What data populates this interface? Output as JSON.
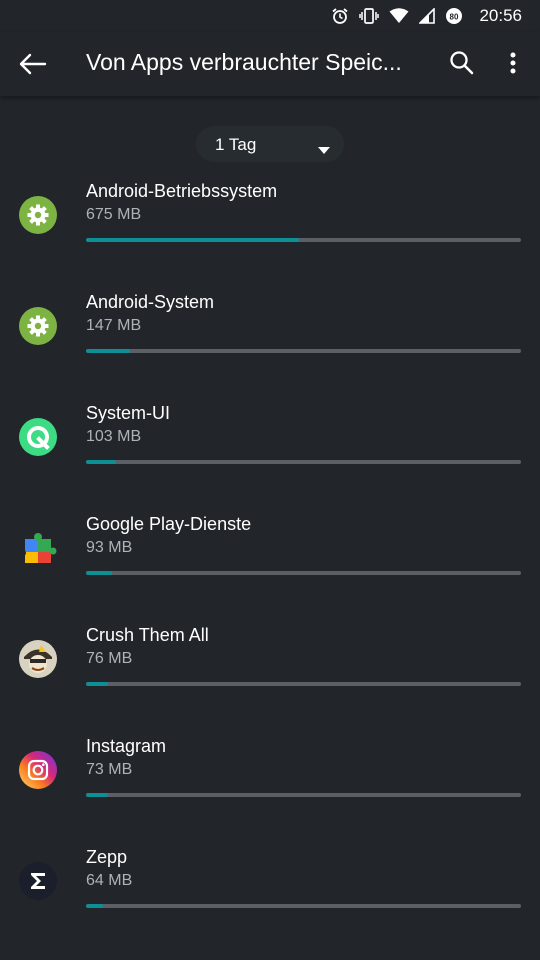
{
  "status_bar": {
    "time": "20:56",
    "icons": [
      "alarm-icon",
      "vibrate-icon",
      "wifi-icon",
      "signal-icon",
      "data-saver-icon"
    ]
  },
  "app_bar": {
    "title": "Von Apps verbrauchter Speic...",
    "back_icon": "arrow-left-icon",
    "search_icon": "search-icon",
    "more_icon": "more-vert-icon"
  },
  "filter": {
    "selected": "1 Tag"
  },
  "colors": {
    "background": "#22262b",
    "accent": "#0e8f96",
    "track": "#5a6066",
    "secondary_text": "#aeb3b8"
  },
  "apps": [
    {
      "name": "Android-Betriebssystem",
      "size": "675 MB",
      "usage_fraction": 0.49,
      "icon": "android-settings-icon"
    },
    {
      "name": "Android-System",
      "size": "147 MB",
      "usage_fraction": 0.1,
      "icon": "android-settings-icon"
    },
    {
      "name": "System-UI",
      "size": "103 MB",
      "usage_fraction": 0.07,
      "icon": "android-q-icon"
    },
    {
      "name": "Google Play-Dienste",
      "size": "93 MB",
      "usage_fraction": 0.06,
      "icon": "play-services-icon"
    },
    {
      "name": "Crush Them All",
      "size": "76 MB",
      "usage_fraction": 0.05,
      "icon": "crush-them-all-icon"
    },
    {
      "name": "Instagram",
      "size": "73 MB",
      "usage_fraction": 0.05,
      "icon": "instagram-icon"
    },
    {
      "name": "Zepp",
      "size": "64 MB",
      "usage_fraction": 0.04,
      "icon": "zepp-icon"
    }
  ]
}
